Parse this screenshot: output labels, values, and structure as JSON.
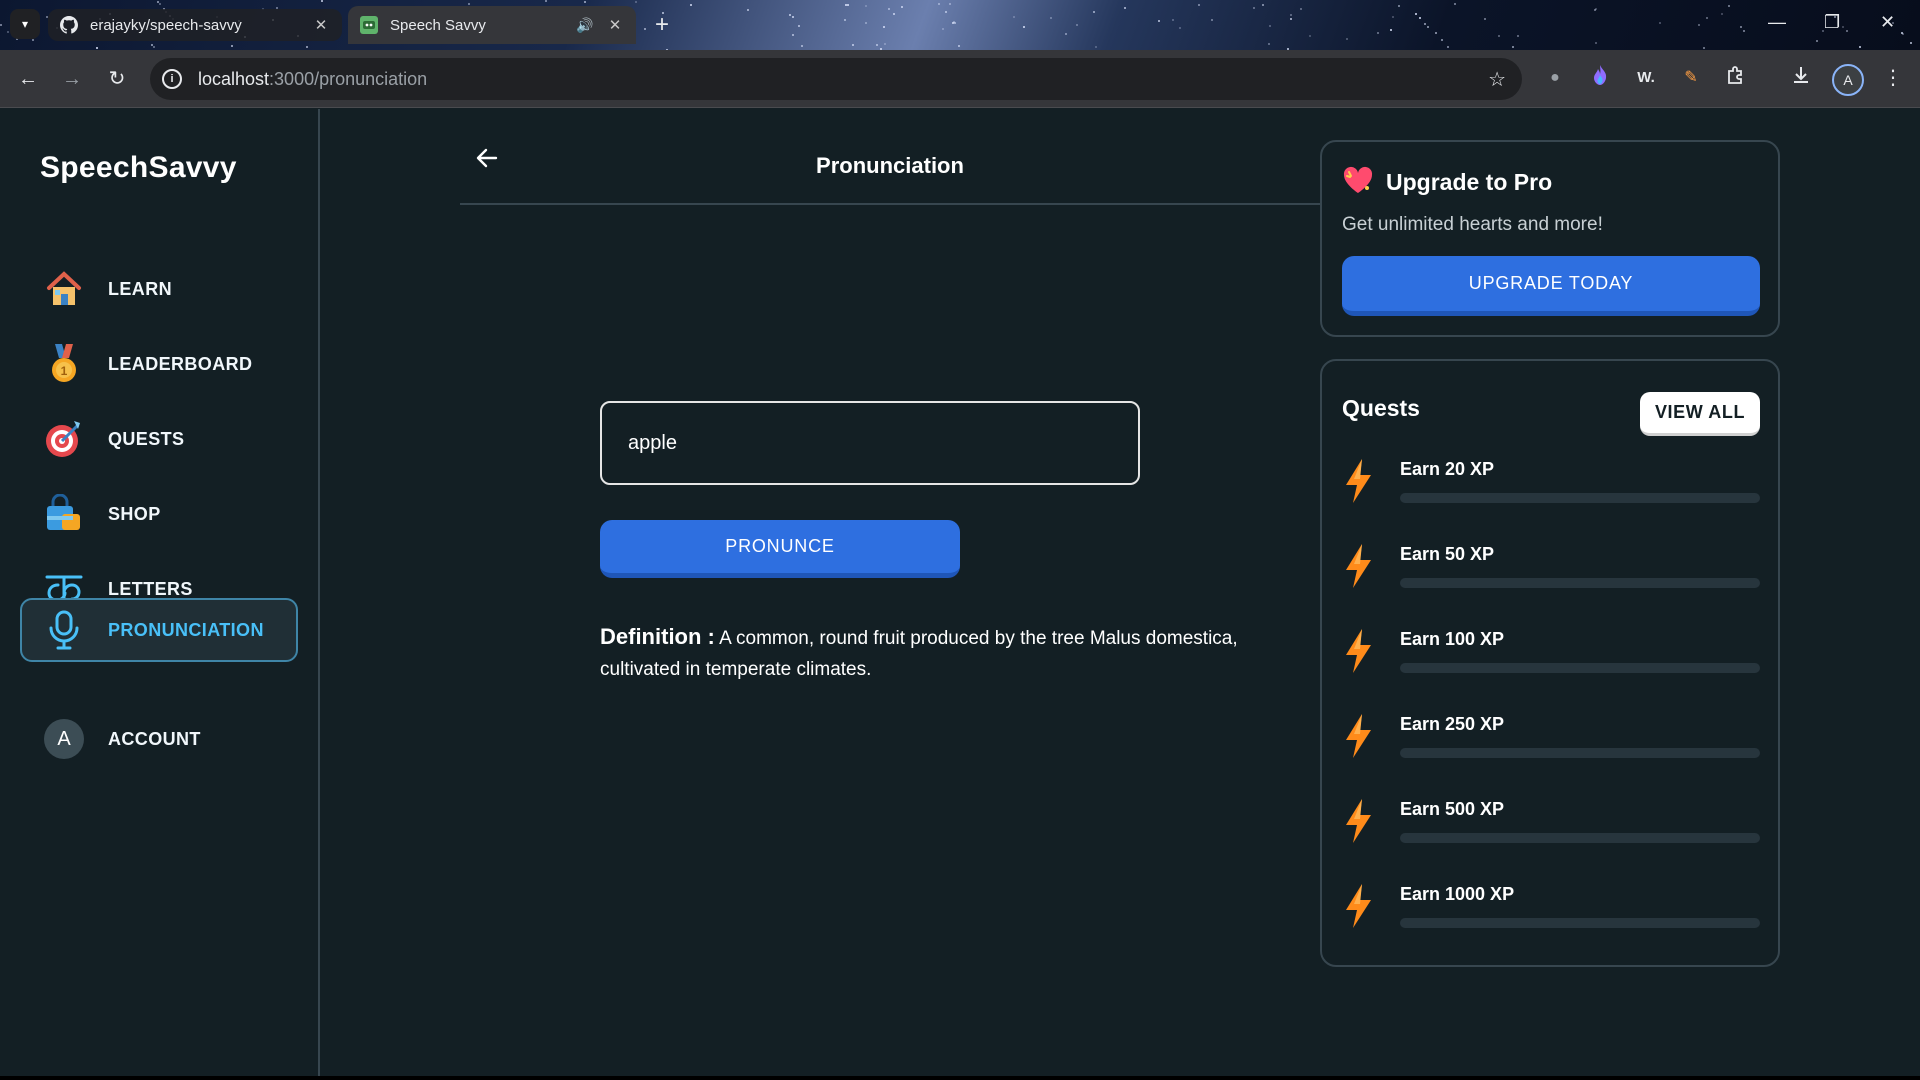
{
  "browser": {
    "tabs": [
      {
        "title": "erajayky/speech-savvy",
        "active": false
      },
      {
        "title": "Speech Savvy",
        "active": true
      }
    ],
    "url_host": "localhost",
    "url_path": ":3000/pronunciation",
    "profile_initial": "A",
    "extension_w": "W."
  },
  "sidebar": {
    "brand": "SpeechSavvy",
    "items": [
      {
        "label": "LEARN",
        "icon": "house-icon"
      },
      {
        "label": "LEADERBOARD",
        "icon": "medal-icon"
      },
      {
        "label": "QUESTS",
        "icon": "target-icon"
      },
      {
        "label": "SHOP",
        "icon": "shopping-bag-icon"
      },
      {
        "label": "LETTERS",
        "icon": "letter-glyph-icon"
      },
      {
        "label": "PRONUNCIATION",
        "icon": "microphone-icon",
        "active": true
      },
      {
        "label": "ACCOUNT",
        "icon": "avatar-icon",
        "initial": "A"
      }
    ]
  },
  "main": {
    "title": "Pronunciation",
    "input_value": "apple",
    "pronounce_label": "PRONUNCE",
    "definition_label": "Definition :",
    "definition_text": "A common, round fruit produced by the tree Malus domestica, cultivated in temperate climates."
  },
  "upgrade": {
    "title": "Upgrade to Pro",
    "subtitle": "Get unlimited hearts and more!",
    "button": "UPGRADE TODAY"
  },
  "quests": {
    "title": "Quests",
    "view_all": "VIEW ALL",
    "items": [
      {
        "label": "Earn 20 XP",
        "progress": 0
      },
      {
        "label": "Earn 50 XP",
        "progress": 0
      },
      {
        "label": "Earn 100 XP",
        "progress": 0
      },
      {
        "label": "Earn 250 XP",
        "progress": 0
      },
      {
        "label": "Earn 500 XP",
        "progress": 0
      },
      {
        "label": "Earn 1000 XP",
        "progress": 0
      }
    ]
  },
  "colors": {
    "background": "#131f24",
    "accent_blue": "#2e6fe0",
    "active_nav": "#49c0f8",
    "border": "#37464f",
    "bolt": "#ff8b1a"
  }
}
